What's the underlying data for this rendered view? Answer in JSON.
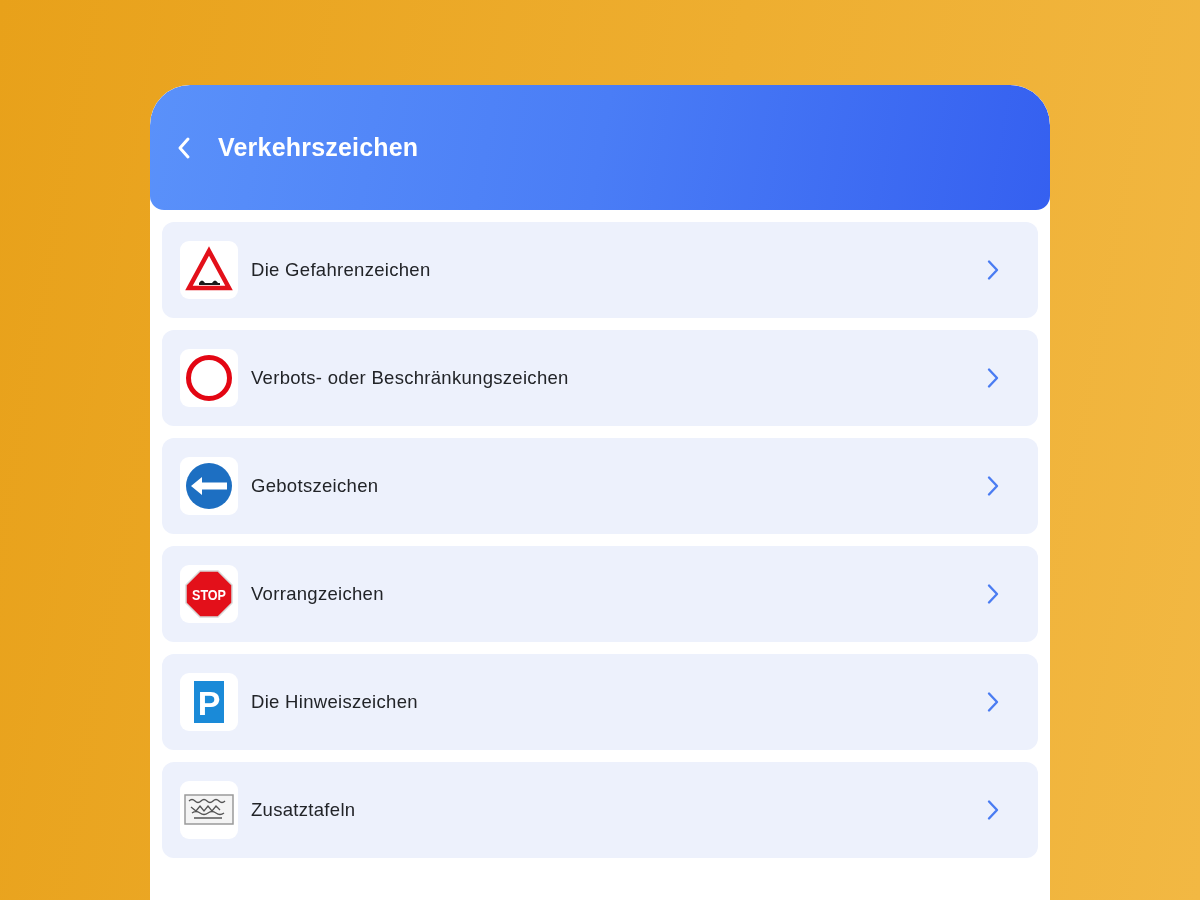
{
  "header": {
    "title": "Verkehrszeichen"
  },
  "categories": [
    {
      "label": "Die Gefahrenzeichen"
    },
    {
      "label": "Verbots- oder Beschränkungszeichen"
    },
    {
      "label": "Gebotszeichen"
    },
    {
      "label": "Vorrangzeichen",
      "sign_text": "STOP"
    },
    {
      "label": "Die Hinweiszeichen",
      "sign_text": "P"
    },
    {
      "label": "Zusatztafeln"
    }
  ]
}
